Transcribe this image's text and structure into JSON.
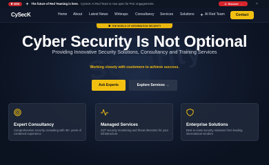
{
  "announcement": {
    "badge": "NEW",
    "bold_text": "The future of Red Teaming is here.",
    "text": "CySecK AI Red Team is now open for PoC engagements.",
    "cta_label": "Discover",
    "close_label": "×"
  },
  "navbar": {
    "logo": "CySecK",
    "items": [
      {
        "label": "Home"
      },
      {
        "label": "About"
      },
      {
        "label": "Latest News"
      },
      {
        "label": "Writeups"
      },
      {
        "label": "Consultancy"
      },
      {
        "label": "Services"
      },
      {
        "label": "Solutions"
      },
      {
        "label": "AI Red Team"
      }
    ],
    "contact_label": "Contact"
  },
  "hero": {
    "pill": "THE WORLD OF INFORMATION SECURITY",
    "background_word": "Security",
    "headline": "Cyber Security Is Not Optional",
    "subtitle": "Providing Innovative Security Solutions, Consultancy and Training Services",
    "tagline": "Working closely with customers to achieve success.",
    "primary_button": "Ask Experts",
    "secondary_button": "Explore Services →"
  },
  "cards": [
    {
      "title": "Expert Consultancy",
      "description": "Comprehensive security consulting with 35+ years of combined experience",
      "icon": "target-icon"
    },
    {
      "title": "Managed Services",
      "description": "24/7 security monitoring and threat detection for your infrastructure",
      "icon": "pulse-icon"
    },
    {
      "title": "Enterprise Solutions",
      "description": "Best-in-class security solutions from leading international vendors",
      "icon": "shield-icon"
    }
  ],
  "colors": {
    "accent": "#f3c012",
    "danger": "#d6252d",
    "background": "#0b1220",
    "card": "#1e283a"
  }
}
